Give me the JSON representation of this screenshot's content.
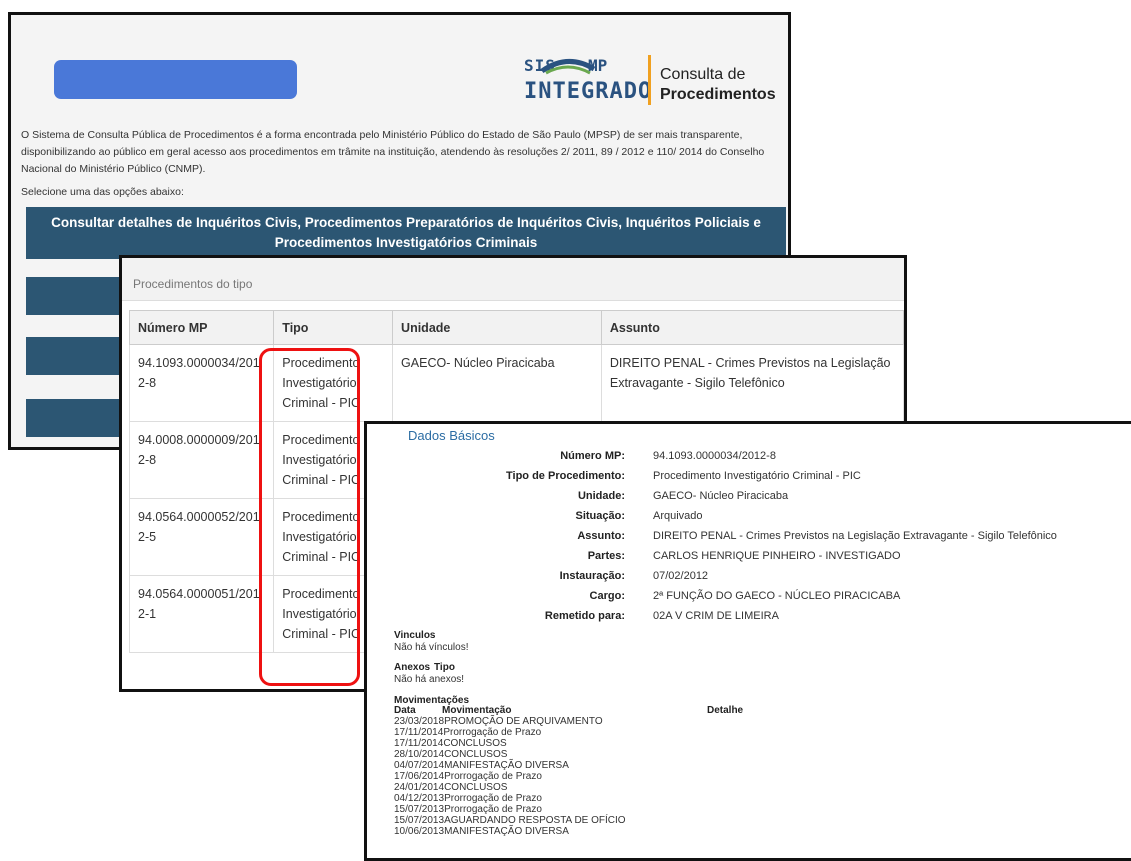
{
  "panel1": {
    "logo": {
      "sis": "SIS",
      "mp": "MP",
      "integrado": "INTEGRADO",
      "line1": "Consulta de",
      "line2": "Procedimentos"
    },
    "intro_text": "O Sistema de Consulta Pública de Procedimentos é a forma encontrada pelo Ministério Público do Estado de São Paulo (MPSP) de ser mais transparente, disponibilizando ao público em geral acesso aos procedimentos em trâmite na instituição, atendendo às resoluções 2/ 2011, 89 / 2012 e 110/ 2014 do Conselho Nacional do Ministério Público (CNMP).",
    "select_text": "Selecione uma das opções abaixo:",
    "option1": "Consultar detalhes de Inquéritos Civis, Procedimentos Preparatórios de Inquéritos Civis, Inquéritos Policiais e Procedimentos Investigatórios Criminais",
    "brand_colors": {
      "dark_band": "#2c5673",
      "blue_bar": "#4a78d8",
      "logo_orange": "#f0a020"
    }
  },
  "panel2": {
    "title": "Procedimentos do tipo",
    "headers": [
      "Número MP",
      "Tipo",
      "Unidade",
      "Assunto"
    ],
    "rows": [
      {
        "numero": "94.1093.0000034/2012-8",
        "tipo": "Procedimento Investigatório Criminal - PIC",
        "unidade": "GAECO- Núcleo Piracicaba",
        "assunto": "DIREITO PENAL - Crimes Previstos na Legislação Extravagante - Sigilo Telefônico"
      },
      {
        "numero": "94.0008.0000009/2012-8",
        "tipo": "Procedimento Investigatório Criminal - PIC",
        "unidade": "",
        "assunto": ""
      },
      {
        "numero": "94.0564.0000052/2012-5",
        "tipo": "Procedimento Investigatório Criminal - PIC",
        "unidade": "",
        "assunto": ""
      },
      {
        "numero": "94.0564.0000051/2012-1",
        "tipo": "Procedimento Investigatório Criminal - PIC",
        "unidade": "",
        "assunto": ""
      }
    ],
    "highlight_color": "#e11111"
  },
  "panel3": {
    "heading": "Dados Básicos",
    "fields": [
      {
        "label": "Número MP:",
        "value": "94.1093.0000034/2012-8"
      },
      {
        "label": "Tipo de Procedimento:",
        "value": "Procedimento Investigatório Criminal - PIC"
      },
      {
        "label": "Unidade:",
        "value": "GAECO- Núcleo Piracicaba"
      },
      {
        "label": "Situação:",
        "value": "Arquivado"
      },
      {
        "label": "Assunto:",
        "value": "DIREITO PENAL - Crimes Previstos na Legislação Extravagante - Sigilo Telefônico"
      },
      {
        "label": "Partes:",
        "value": "CARLOS HENRIQUE PINHEIRO - INVESTIGADO"
      },
      {
        "label": "Instauração:",
        "value": "07/02/2012"
      },
      {
        "label": "Cargo:",
        "value": "2ª FUNÇÃO DO GAECO - NÚCLEO PIRACICABA"
      },
      {
        "label": "Remetido para:",
        "value": "02A V CRIM DE LIMEIRA"
      }
    ],
    "vinculos_title": "Vinculos",
    "vinculos_text": "Não há vínculos!",
    "anexos_title": "Anexos",
    "anexos_tipo": "Tipo",
    "anexos_text": "Não há anexos!",
    "mov_title": "Movimentações",
    "mov_headers": [
      "Data",
      "Movimentação",
      "Detalhe"
    ],
    "movimentacoes": [
      {
        "data": "23/03/2018",
        "mov": "PROMOÇÃO DE ARQUIVAMENTO"
      },
      {
        "data": "17/11/2014",
        "mov": "Prorrogação de Prazo"
      },
      {
        "data": "17/11/2014",
        "mov": "CONCLUSOS"
      },
      {
        "data": "28/10/2014",
        "mov": "CONCLUSOS"
      },
      {
        "data": "04/07/2014",
        "mov": "MANIFESTAÇÃO DIVERSA"
      },
      {
        "data": "17/06/2014",
        "mov": "Prorrogação de Prazo"
      },
      {
        "data": "24/01/2014",
        "mov": "CONCLUSOS"
      },
      {
        "data": "04/12/2013",
        "mov": "Prorrogação de Prazo"
      },
      {
        "data": "15/07/2013",
        "mov": "Prorrogação de Prazo"
      },
      {
        "data": "15/07/2013",
        "mov": "AGUARDANDO RESPOSTA DE OFÍCIO"
      },
      {
        "data": "10/06/2013",
        "mov": "MANIFESTAÇÃO DIVERSA"
      }
    ]
  }
}
